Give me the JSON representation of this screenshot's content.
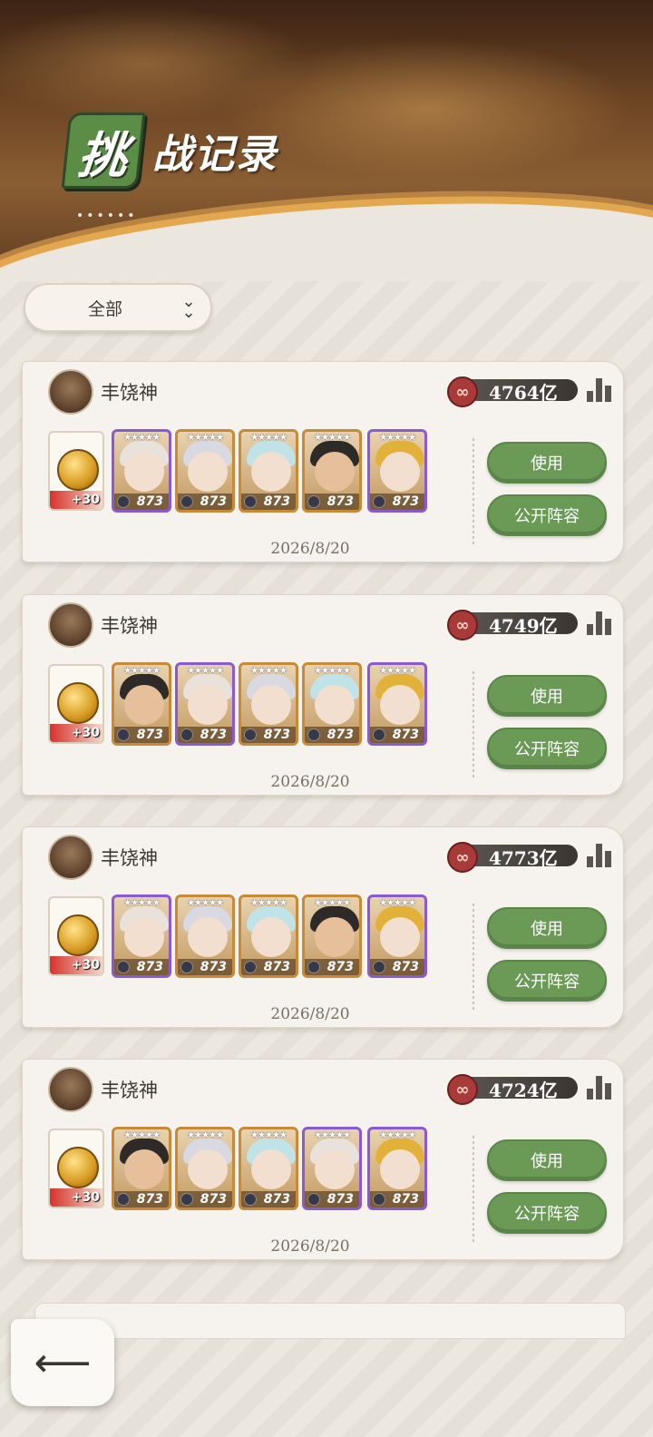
{
  "header": {
    "title_badge_char": "挑",
    "title_rest": "战记录",
    "dots": "••••••"
  },
  "filter": {
    "label": "全部",
    "icon": "double-chevron-down-icon"
  },
  "records": [
    {
      "player_name": "丰饶神",
      "power": "4764亿",
      "item_plus": "+30",
      "levels": [
        "873",
        "873",
        "873",
        "873",
        "873"
      ],
      "use_label": "使用",
      "publish_label": "公开阵容",
      "date": "2026/8/20"
    },
    {
      "player_name": "丰饶神",
      "power": "4749亿",
      "item_plus": "+30",
      "levels": [
        "873",
        "873",
        "873",
        "873",
        "873"
      ],
      "use_label": "使用",
      "publish_label": "公开阵容",
      "date": "2026/8/20"
    },
    {
      "player_name": "丰饶神",
      "power": "4773亿",
      "item_plus": "+30",
      "levels": [
        "873",
        "873",
        "873",
        "873",
        "873"
      ],
      "use_label": "使用",
      "publish_label": "公开阵容",
      "date": "2026/8/20"
    },
    {
      "player_name": "丰饶神",
      "power": "4724亿",
      "item_plus": "+30",
      "levels": [
        "873",
        "873",
        "873",
        "873",
        "873"
      ],
      "use_label": "使用",
      "publish_label": "公开阵容",
      "date": "2026/8/20"
    }
  ],
  "back_button": {
    "icon": "back-arrow-icon",
    "glyph": "⟵"
  },
  "colors": {
    "button_green": "#6a9a56",
    "title_badge_green": "#5c8d46",
    "power_emblem": "#a83a3a"
  }
}
